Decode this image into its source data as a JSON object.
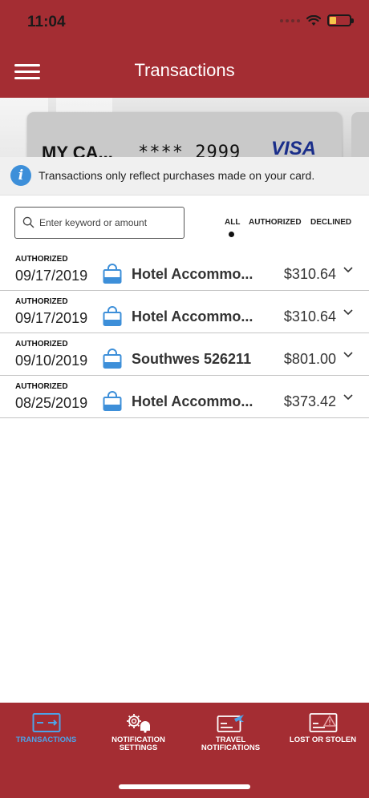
{
  "status_bar": {
    "time": "11:04"
  },
  "header": {
    "title": "Transactions",
    "menu_icon": "hamburger-menu-icon"
  },
  "card": {
    "name": "MY CA...",
    "masked_number": "**** 2999",
    "brand": "VISA"
  },
  "info_bar": {
    "icon": "info-icon",
    "text": "Transactions only reflect purchases made on your card."
  },
  "search": {
    "placeholder": "Enter keyword or amount",
    "value": ""
  },
  "filters": {
    "tabs": [
      "ALL",
      "AUTHORIZED",
      "DECLINED"
    ],
    "active": "ALL"
  },
  "transactions": [
    {
      "status": "AUTHORIZED",
      "date": "09/17/2019",
      "merchant": "Hotel Accommo...",
      "amount": "$310.64",
      "icon": "shopping-bag-icon"
    },
    {
      "status": "AUTHORIZED",
      "date": "09/17/2019",
      "merchant": "Hotel Accommo...",
      "amount": "$310.64",
      "icon": "shopping-bag-icon"
    },
    {
      "status": "AUTHORIZED",
      "date": "09/10/2019",
      "merchant": "Southwes 526211",
      "amount": "$801.00",
      "icon": "shopping-bag-icon"
    },
    {
      "status": "AUTHORIZED",
      "date": "08/25/2019",
      "merchant": "Hotel Accommo...",
      "amount": "$373.42",
      "icon": "shopping-bag-icon"
    }
  ],
  "bottom_nav": {
    "items": [
      {
        "label": "TRANSACTIONS",
        "icon": "card-transactions-icon",
        "active": true
      },
      {
        "label": "NOTIFICATION SETTINGS",
        "icon": "notification-settings-icon",
        "active": false
      },
      {
        "label": "TRAVEL NOTIFICATIONS",
        "icon": "travel-notifications-icon",
        "active": false
      },
      {
        "label": "LOST OR STOLEN",
        "icon": "lost-stolen-card-icon",
        "active": false
      }
    ]
  },
  "colors": {
    "brand_red": "#a42d33",
    "accent_blue": "#3d8fd9",
    "active_nav": "#4da3e8"
  }
}
